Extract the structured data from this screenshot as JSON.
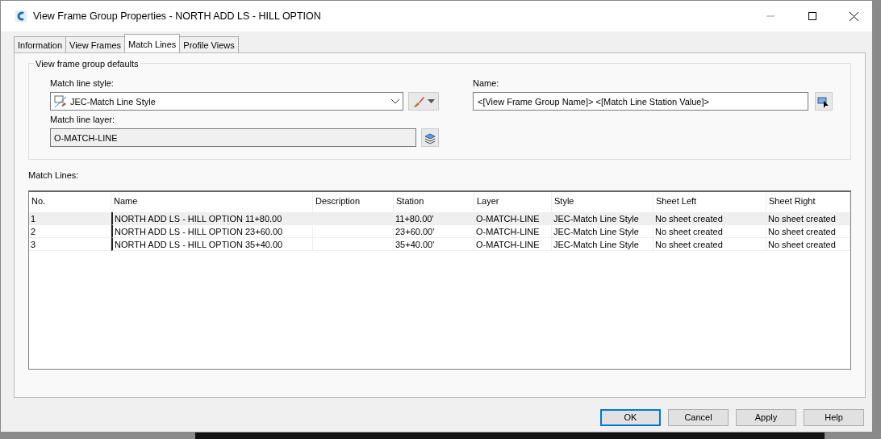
{
  "window": {
    "title": "View Frame Group Properties - NORTH ADD LS - HILL OPTION"
  },
  "tabs": [
    {
      "label": "Information",
      "selected": false
    },
    {
      "label": "View Frames",
      "selected": false
    },
    {
      "label": "Match Lines",
      "selected": true
    },
    {
      "label": "Profile Views",
      "selected": false
    }
  ],
  "defaults": {
    "legend": "View frame group defaults",
    "style_label": "Match line style:",
    "style_value": "JEC-Match Line Style",
    "layer_label": "Match line layer:",
    "layer_value": "O-MATCH-LINE",
    "name_label": "Name:",
    "name_value": "<[View Frame Group Name]> <[Match Line Station Value]>"
  },
  "table": {
    "label": "Match Lines:",
    "columns": [
      "No.",
      "Name",
      "Description",
      "Station",
      "Layer",
      "Style",
      "Sheet Left",
      "Sheet Right"
    ],
    "rows": [
      {
        "selected": true,
        "cells": [
          "1",
          "NORTH ADD LS - HILL OPTION 11+80.00",
          "",
          "11+80.00'",
          "O-MATCH-LINE",
          "JEC-Match Line Style",
          "No sheet created",
          "No sheet created"
        ]
      },
      {
        "selected": false,
        "cells": [
          "2",
          "NORTH ADD LS - HILL OPTION 23+60.00",
          "",
          "23+60.00'",
          "O-MATCH-LINE",
          "JEC-Match Line Style",
          "No sheet created",
          "No sheet created"
        ]
      },
      {
        "selected": false,
        "cells": [
          "3",
          "NORTH ADD LS - HILL OPTION 35+40.00",
          "",
          "35+40.00'",
          "O-MATCH-LINE",
          "JEC-Match Line Style",
          "No sheet created",
          "No sheet created"
        ]
      }
    ]
  },
  "buttons": [
    {
      "label": "OK",
      "default": true
    },
    {
      "label": "Cancel",
      "default": false
    },
    {
      "label": "Apply",
      "default": false
    },
    {
      "label": "Help",
      "default": false
    }
  ]
}
